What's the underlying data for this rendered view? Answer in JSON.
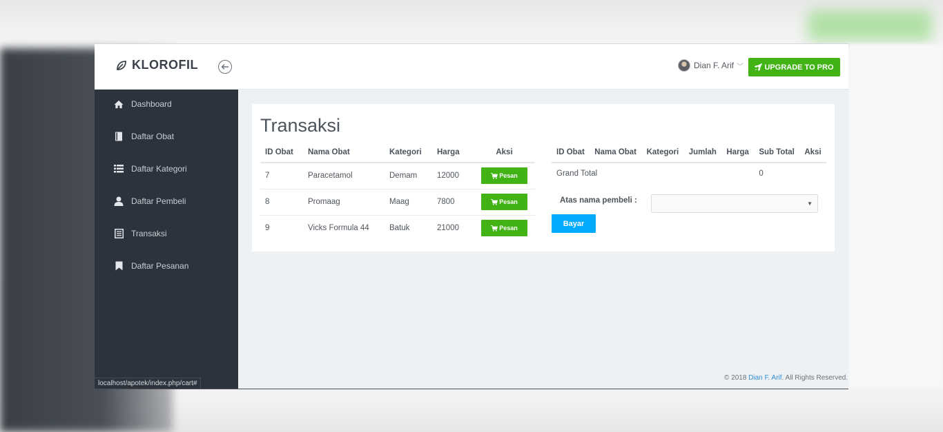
{
  "brand": {
    "name": "KLOROFIL"
  },
  "header": {
    "user_name": "Dian F. Arif",
    "upgrade_label": "UPGRADE TO PRO"
  },
  "sidebar": {
    "items": [
      {
        "label": "Dashboard",
        "icon": "home-icon"
      },
      {
        "label": "Daftar Obat",
        "icon": "book-icon"
      },
      {
        "label": "Daftar Kategori",
        "icon": "list-icon"
      },
      {
        "label": "Daftar Pembeli",
        "icon": "user-icon"
      },
      {
        "label": "Transaksi",
        "icon": "document-icon"
      },
      {
        "label": "Daftar Pesanan",
        "icon": "bookmark-icon"
      }
    ]
  },
  "status_bar": {
    "url": "localhost/apotek/index.php/cart#"
  },
  "main": {
    "title": "Transaksi",
    "products": {
      "headers": [
        "ID Obat",
        "Nama Obat",
        "Kategori",
        "Harga",
        "Aksi"
      ],
      "rows": [
        {
          "id": "7",
          "name": "Paracetamol",
          "category": "Demam",
          "price": "12000",
          "action": "Pesan"
        },
        {
          "id": "8",
          "name": "Promaag",
          "category": "Maag",
          "price": "7800",
          "action": "Pesan"
        },
        {
          "id": "9",
          "name": "Vicks Formula 44",
          "category": "Batuk",
          "price": "21000",
          "action": "Pesan"
        }
      ]
    },
    "cart": {
      "headers": [
        "ID Obat",
        "Nama Obat",
        "Kategori",
        "Jumlah",
        "Harga",
        "Sub Total",
        "Aksi"
      ],
      "grand_total_label": "Grand Total",
      "grand_total_value": "0",
      "buyer_label": "Atas nama pembeli :",
      "buyer_selected": "",
      "pay_label": "Bayar"
    }
  },
  "footer": {
    "prefix": "© 2018 ",
    "author": "Dian F. Arif",
    "suffix": ". All Rights Reserved."
  },
  "colors": {
    "sidebar_bg": "#2c333d",
    "accent_green": "#41b314",
    "accent_blue": "#00aaff",
    "link_blue": "#2b8fd6"
  }
}
